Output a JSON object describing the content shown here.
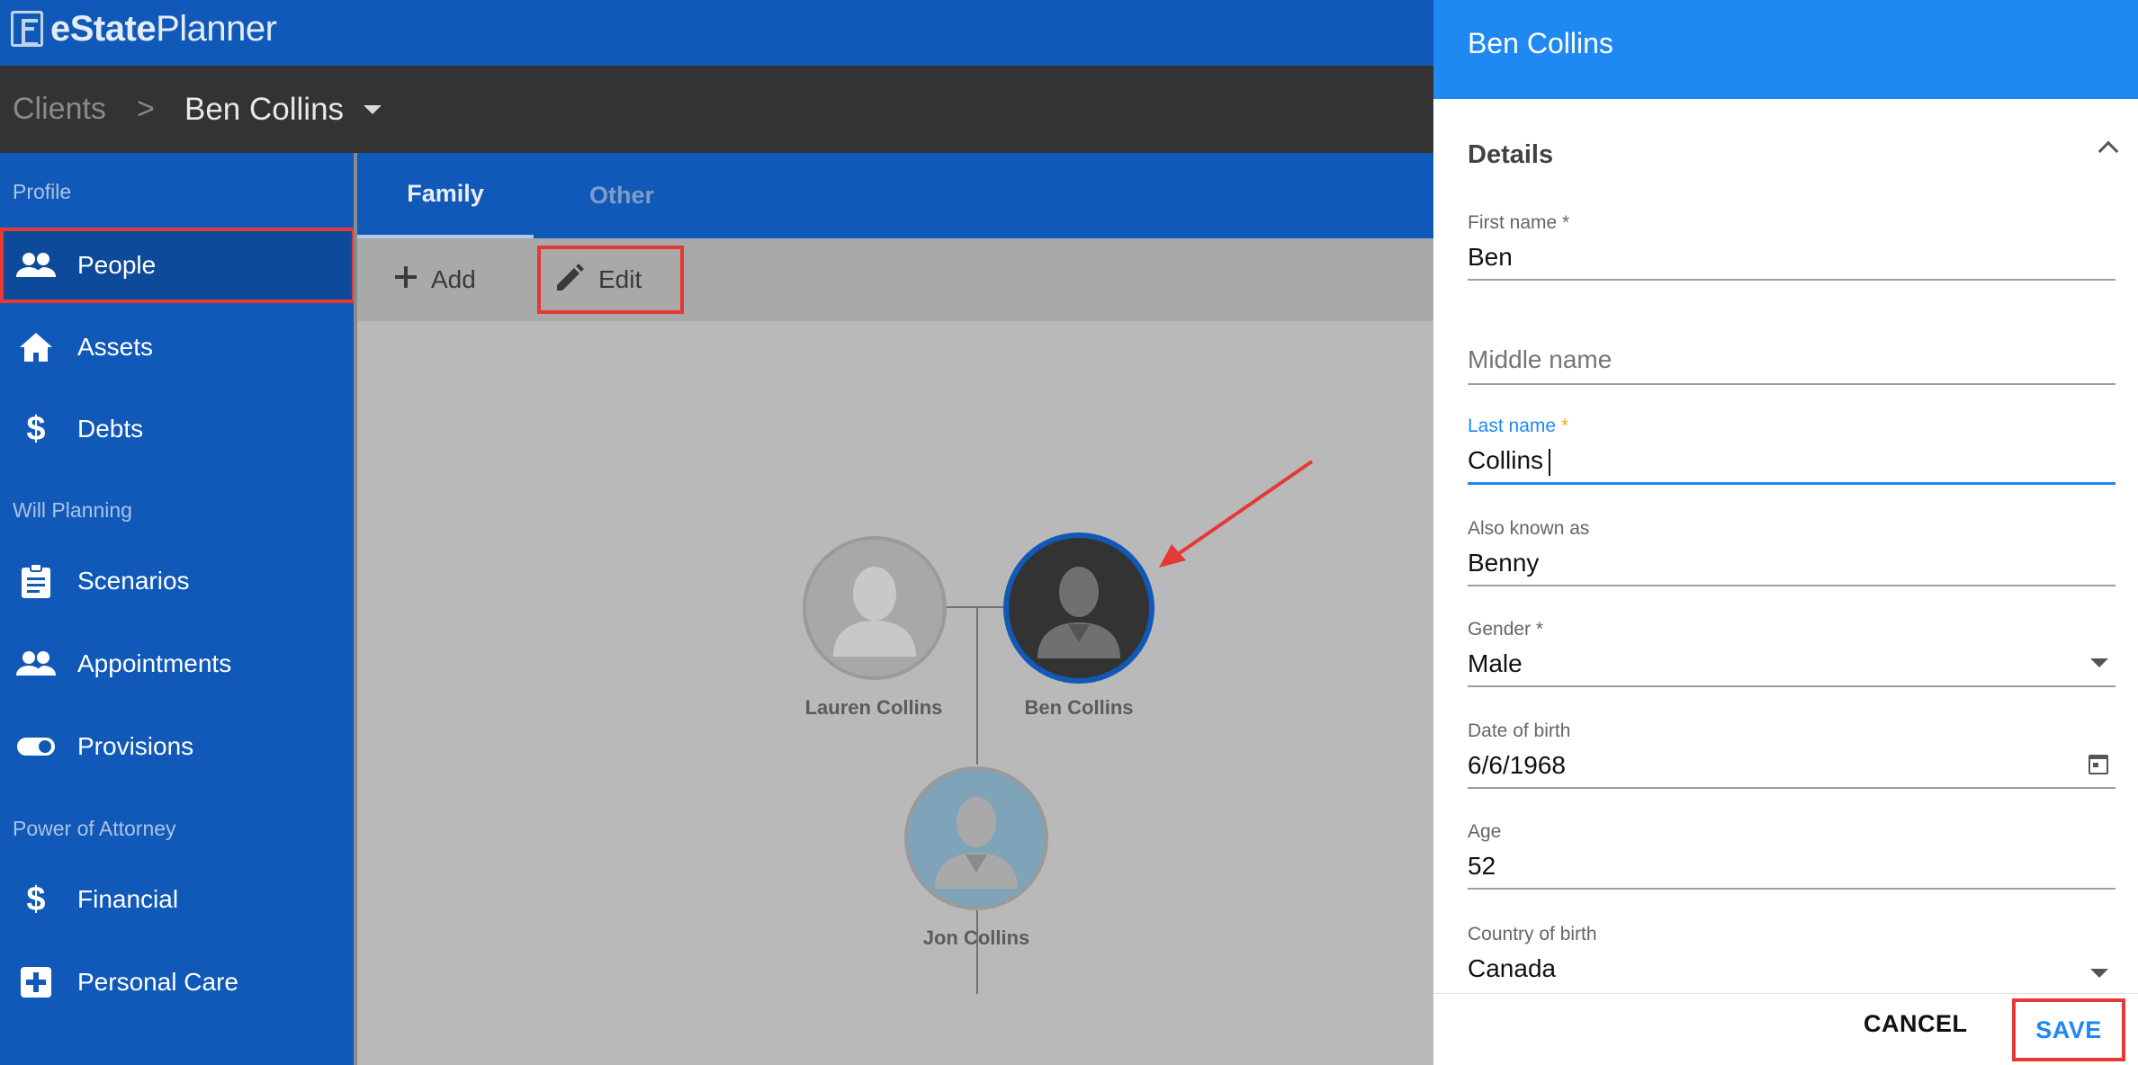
{
  "app": {
    "brand_bold": "eState",
    "brand_light": "Planner"
  },
  "breadcrumb": {
    "root": "Clients",
    "separator": ">",
    "current": "Ben Collins"
  },
  "sidebar": {
    "sections": [
      {
        "label": "Profile"
      },
      {
        "label": "Will Planning"
      },
      {
        "label": "Power of Attorney"
      }
    ],
    "items": [
      {
        "label": "People",
        "icon": "people-icon",
        "active": true
      },
      {
        "label": "Assets",
        "icon": "home-icon"
      },
      {
        "label": "Debts",
        "icon": "dollar-icon"
      },
      {
        "label": "Scenarios",
        "icon": "clipboard-icon"
      },
      {
        "label": "Appointments",
        "icon": "people-icon"
      },
      {
        "label": "Provisions",
        "icon": "toggle-icon"
      },
      {
        "label": "Financial",
        "icon": "dollar-icon"
      },
      {
        "label": "Personal Care",
        "icon": "medical-cross-icon"
      }
    ]
  },
  "tabs": [
    {
      "label": "Family",
      "active": true
    },
    {
      "label": "Other"
    }
  ],
  "toolbar": {
    "add_label": "Add",
    "edit_label": "Edit"
  },
  "family_tree": {
    "people": [
      {
        "name": "Lauren Collins"
      },
      {
        "name": "Ben Collins",
        "selected": true
      },
      {
        "name": "Jon Collins"
      }
    ]
  },
  "panel": {
    "title": "Ben Collins",
    "section_title": "Details",
    "fields": {
      "first_name": {
        "label": "First name *",
        "value": "Ben"
      },
      "middle_name": {
        "placeholder": "Middle name"
      },
      "last_name": {
        "label": "Last name",
        "required_mark": "*",
        "value": "Collins"
      },
      "aka": {
        "label": "Also known as",
        "value": "Benny"
      },
      "gender": {
        "label": "Gender *",
        "value": "Male"
      },
      "dob": {
        "label": "Date of birth",
        "value": "6/6/1968"
      },
      "age": {
        "label": "Age",
        "value": "52"
      },
      "country": {
        "label": "Country of birth",
        "value": "Canada"
      }
    },
    "cancel_label": "CANCEL",
    "save_label": "SAVE"
  },
  "colors": {
    "primary": "#1159b8",
    "panel_header": "#1e88f3",
    "highlight": "#e53935",
    "crumb_bar": "#333333"
  }
}
